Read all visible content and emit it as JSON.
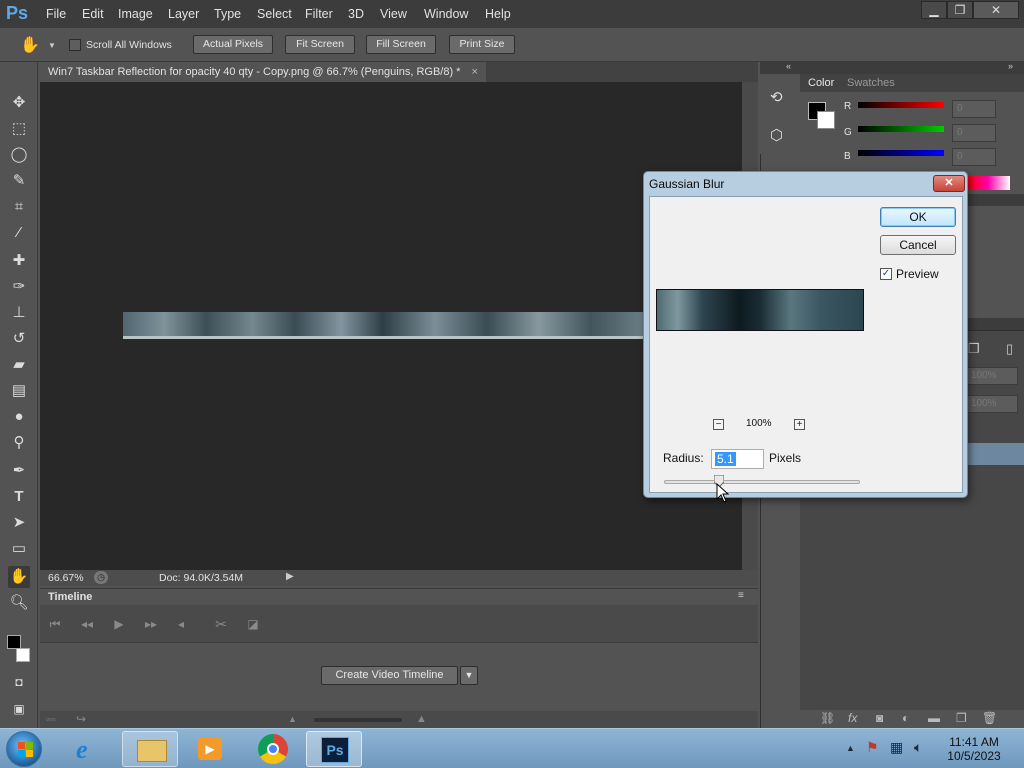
{
  "app": {
    "logo": "Ps",
    "menu": [
      "File",
      "Edit",
      "Image",
      "Layer",
      "Type",
      "Select",
      "Filter",
      "3D",
      "View",
      "Window",
      "Help"
    ],
    "window_controls": [
      "minimize-icon",
      "restore-icon",
      "close-icon"
    ]
  },
  "options": {
    "scroll_all_windows": "Scroll All Windows",
    "scroll_all_checked": false,
    "buttons": [
      "Actual Pixels",
      "Fit Screen",
      "Fill Screen",
      "Print Size"
    ]
  },
  "document": {
    "tab_title": "Win7 Taskbar Reflection for opacity 40 qty  - Copy.png @ 66.7% (Penguins, RGB/8) *",
    "tab_close": "×",
    "zoom": "66.67%",
    "doc_info": "Doc: 94.0K/3.54M"
  },
  "timeline": {
    "title": "Timeline",
    "create_button": "Create Video Timeline"
  },
  "color_panel": {
    "tabs": [
      "Color",
      "Swatches"
    ],
    "channels": [
      {
        "label": "R",
        "value": "0"
      },
      {
        "label": "G",
        "value": "0"
      },
      {
        "label": "B",
        "value": "0"
      }
    ],
    "lower_values": [
      "100%",
      "100%"
    ]
  },
  "dialog": {
    "title": "Gaussian Blur",
    "close": "✕",
    "ok": "OK",
    "cancel": "Cancel",
    "preview_label": "Preview",
    "preview_checked": true,
    "zoom_level": "100%",
    "zoom_out": "−",
    "zoom_in": "+",
    "radius_label": "Radius:",
    "radius_value": "5.1",
    "radius_unit": "Pixels"
  },
  "taskbar": {
    "items": [
      "start-orb-icon",
      "internet-explorer-icon",
      "explorer-icon",
      "media-player-icon",
      "chrome-icon",
      "photoshop-icon"
    ],
    "logo_ps": "Ps",
    "time": "11:41 AM",
    "date": "10/5/2023"
  },
  "colors": {
    "accent": "#3399ff",
    "dialog_frame": "#b7cde0",
    "canvas": "#282828"
  }
}
